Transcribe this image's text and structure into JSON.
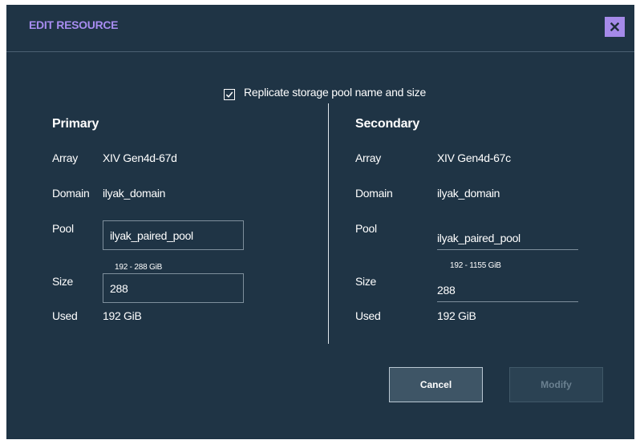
{
  "dialog": {
    "title": "EDIT RESOURCE",
    "close_icon": "close-icon",
    "accent_color": "#a58ae9",
    "background_color": "#1f3445"
  },
  "replicate": {
    "label": "Replicate storage pool name and size",
    "checked": true
  },
  "primary": {
    "title": "Primary",
    "array_label": "Array",
    "array_value": "XIV Gen4d-67d",
    "domain_label": "Domain",
    "domain_value": "ilyak_domain",
    "pool_label": "Pool",
    "pool_value": "ilyak_paired_pool",
    "size_label": "Size",
    "size_range": "192 - 288 GiB",
    "size_value": "288",
    "used_label": "Used",
    "used_value": "192 GiB"
  },
  "secondary": {
    "title": "Secondary",
    "array_label": "Array",
    "array_value": "XIV Gen4d-67c",
    "domain_label": "Domain",
    "domain_value": "ilyak_domain",
    "pool_label": "Pool",
    "pool_value": "ilyak_paired_pool",
    "size_label": "Size",
    "size_range": "192 - 1155 GiB",
    "size_value": "288",
    "used_label": "Used",
    "used_value": "192 GiB"
  },
  "buttons": {
    "cancel_label": "Cancel",
    "modify_label": "Modify",
    "modify_enabled": false
  }
}
